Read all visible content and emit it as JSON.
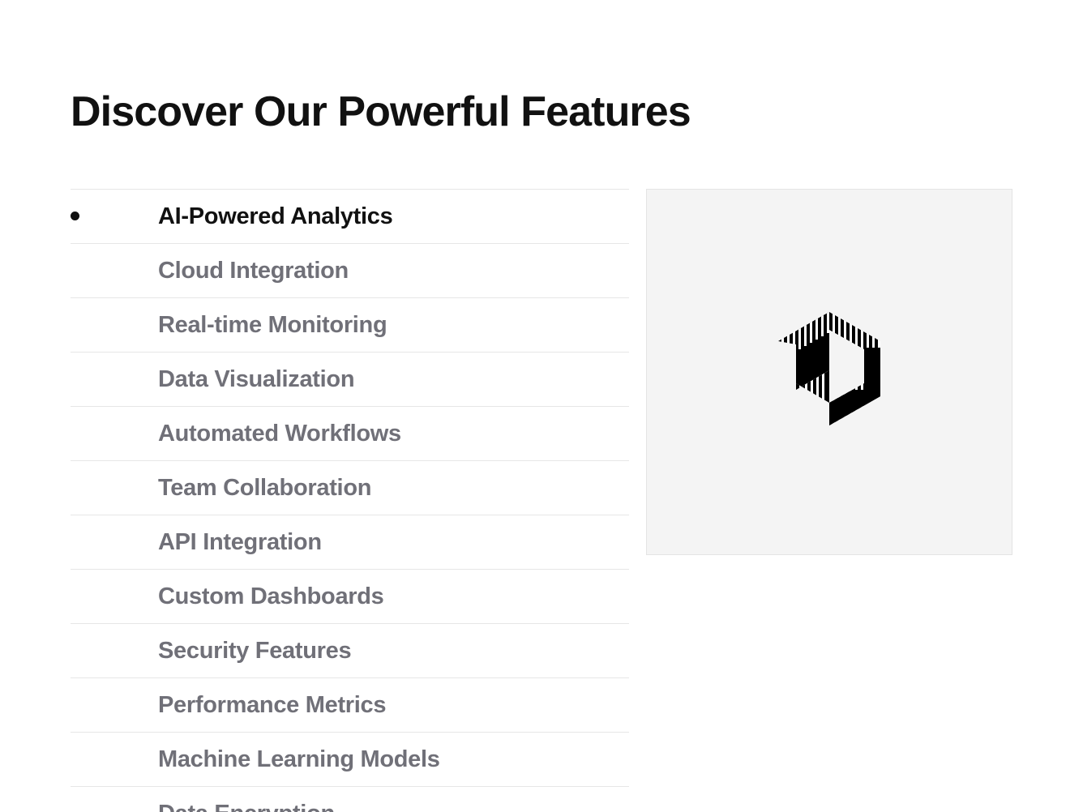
{
  "header": {
    "title": "Discover Our Powerful Features"
  },
  "features": {
    "items": [
      {
        "label": "AI-Powered Analytics",
        "active": true
      },
      {
        "label": "Cloud Integration",
        "active": false
      },
      {
        "label": "Real-time Monitoring",
        "active": false
      },
      {
        "label": "Data Visualization",
        "active": false
      },
      {
        "label": "Automated Workflows",
        "active": false
      },
      {
        "label": "Team Collaboration",
        "active": false
      },
      {
        "label": "API Integration",
        "active": false
      },
      {
        "label": "Custom Dashboards",
        "active": false
      },
      {
        "label": "Security Features",
        "active": false
      },
      {
        "label": "Performance Metrics",
        "active": false
      },
      {
        "label": "Machine Learning Models",
        "active": false
      },
      {
        "label": "Data Encryption",
        "active": false
      }
    ]
  },
  "preview": {
    "icon": "striped-hexagon-logo-icon"
  },
  "colors": {
    "active_text": "#111111",
    "inactive_text": "#707078",
    "panel_background": "#f4f4f4"
  }
}
